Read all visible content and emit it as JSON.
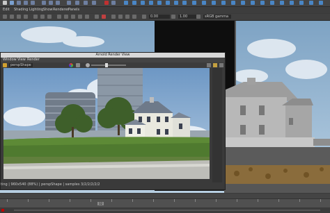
{
  "main_menu": {
    "items": [
      "Edit",
      "Shading",
      "Lighting",
      "Show",
      "Renderer",
      "Panels"
    ]
  },
  "viewport_toolbar": {
    "field_1": "0.00",
    "field_2": "1.00",
    "color_space": "sRGB gamma"
  },
  "render_view": {
    "title": "Arnold Render View",
    "menu": [
      "Window",
      "View",
      "Render"
    ],
    "camera": "perspShape",
    "status": "ting | 960x540 (88%) | perspShape | samples 3/2/2/2/2/2"
  },
  "timeline": {
    "marker_value": "32"
  },
  "colors": {
    "sky": "#8fb3d3",
    "grass": "#4f7a2f",
    "render_title_bar": "#d8d8d8",
    "playhead": "#c00000"
  },
  "icons": [
    "render-icon",
    "snapshot-icon",
    "channel-rgb-icon",
    "lock-icon",
    "play-icon"
  ]
}
